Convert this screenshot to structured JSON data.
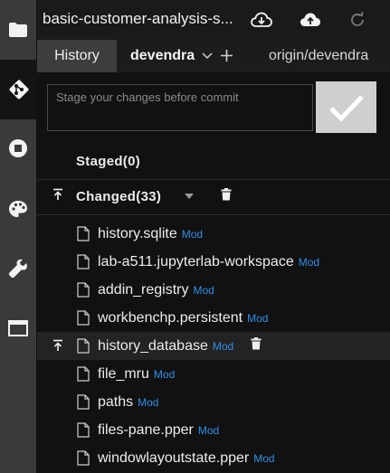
{
  "rail": {
    "items": [
      {
        "icon": "folder-icon"
      },
      {
        "icon": "git-icon"
      },
      {
        "icon": "stop-circle-icon"
      },
      {
        "icon": "palette-icon"
      },
      {
        "icon": "wrench-icon"
      },
      {
        "icon": "window-icon"
      }
    ],
    "active_index": 1
  },
  "header": {
    "repo_name": "basic-customer-analysis-s...",
    "icons": [
      "cloud-download-icon",
      "cloud-upload-icon",
      "refresh-icon"
    ]
  },
  "branch_bar": {
    "history_tab": "History",
    "current_branch": "devendra",
    "remote_branch": "origin/devendra"
  },
  "commit": {
    "placeholder": "Stage your changes before commit"
  },
  "staged": {
    "title": "Staged(0)"
  },
  "changed": {
    "title": "Changed(33)",
    "files": [
      {
        "name": "history.sqlite",
        "status": "Mod"
      },
      {
        "name": "lab-a511.jupyterlab-workspace",
        "status": "Mod"
      },
      {
        "name": "addin_registry",
        "status": "Mod"
      },
      {
        "name": "workbenchp.persistent",
        "status": "Mod"
      },
      {
        "name": "history_database",
        "status": "Mod"
      },
      {
        "name": "file_mru",
        "status": "Mod"
      },
      {
        "name": "paths",
        "status": "Mod"
      },
      {
        "name": "files-pane.pper",
        "status": "Mod"
      },
      {
        "name": "windowlayoutstate.pper",
        "status": "Mod"
      }
    ],
    "hovered_index": 4
  },
  "colors": {
    "accent_status": "#2f8fe8",
    "rail_bg": "#3a3a3a",
    "panel_bg": "#111111"
  }
}
